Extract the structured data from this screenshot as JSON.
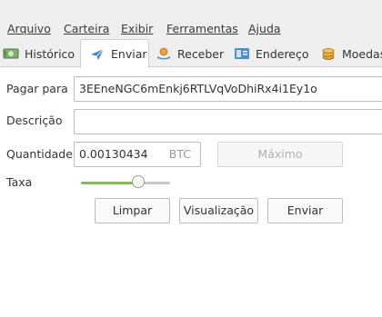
{
  "menu": {
    "items": [
      "Arquivo",
      "Carteira",
      "Exibir",
      "Ferramentas",
      "Ajuda"
    ]
  },
  "tabs": [
    {
      "label": "Histórico",
      "icon": "history-icon",
      "active": false
    },
    {
      "label": "Enviar",
      "icon": "send-icon",
      "active": true
    },
    {
      "label": "Receber",
      "icon": "receive-icon",
      "active": false
    },
    {
      "label": "Endereço",
      "icon": "address-icon",
      "active": false
    },
    {
      "label": "Moedas",
      "icon": "coins-icon",
      "active": false
    }
  ],
  "form": {
    "pay_to_label": "Pagar para",
    "pay_to_value": "3EEneNGC6mEnkj6RTLVqVoDhiRx4i1Ey1o",
    "description_label": "Descrição",
    "description_value": "",
    "amount_label": "Quantidade",
    "amount_value": "0.00130434",
    "amount_unit": "BTC",
    "max_label": "Máximo",
    "fee_label": "Taxa",
    "fee_slider_level": 0.64
  },
  "buttons": {
    "clear": "Limpar",
    "preview": "Visualização",
    "send": "Enviar"
  },
  "colors": {
    "slider_fill": "#8bb66b",
    "send_icon": "#3d7fd1"
  }
}
